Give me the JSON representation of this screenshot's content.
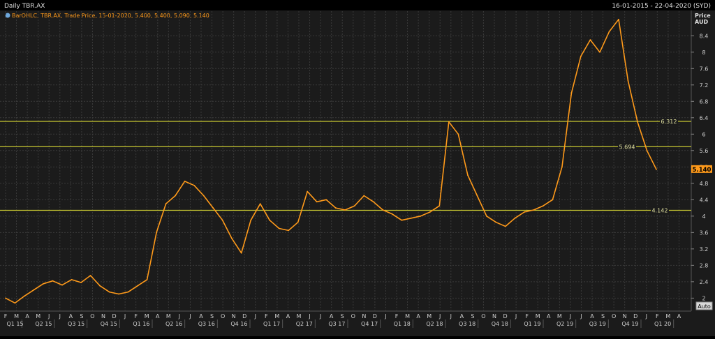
{
  "header": {
    "title": "Daily TBR.AX",
    "date_range": "16-01-2015 - 22-04-2020 (SYD)"
  },
  "legend": {
    "text": "BarOHLC, TBR.AX, Trade Price, 15-01-2020, 5.400, 5.400, 5.090, 5.140"
  },
  "axis": {
    "price_label": "Price",
    "unit_label": "AUD",
    "last_price": "5.140",
    "auto_label": "Auto"
  },
  "colors": {
    "background": "#1b1b1b",
    "grid": "#3a3a3a",
    "series": "#ff9a1a",
    "hline": "#c8c832",
    "title_bar": "#000000",
    "axis_text": "#cfcfcf",
    "last_price_bg": "#ff9a1a"
  },
  "chart_data": {
    "type": "line",
    "title": "Daily TBR.AX",
    "ylabel": "Price AUD",
    "ylim": [
      1.7,
      9.0
    ],
    "yticks": [
      "2",
      "2.4",
      "2.8",
      "3.2",
      "3.6",
      "4",
      "4.4",
      "4.8",
      "5.2",
      "5.6",
      "6",
      "6.4",
      "6.8",
      "7.2",
      "7.6",
      "8",
      "8.4"
    ],
    "months": [
      "F",
      "M",
      "A",
      "M",
      "J",
      "J",
      "A",
      "S",
      "O",
      "N",
      "D",
      "J",
      "F",
      "M",
      "A",
      "M",
      "J",
      "J",
      "A",
      "S",
      "O",
      "N",
      "D",
      "J",
      "F",
      "M",
      "A",
      "M",
      "J",
      "J",
      "A",
      "S",
      "O",
      "N",
      "D",
      "J",
      "F",
      "M",
      "A",
      "M",
      "J",
      "J",
      "A",
      "S",
      "O",
      "N",
      "D",
      "J",
      "F",
      "M",
      "A",
      "M",
      "J",
      "J",
      "A",
      "S",
      "O",
      "N",
      "D",
      "J",
      "F",
      "M",
      "A"
    ],
    "quarters": [
      "Q1 15",
      "Q2 15",
      "Q3 15",
      "Q4 15",
      "Q1 16",
      "Q2 16",
      "Q3 16",
      "Q4 16",
      "Q1 17",
      "Q2 17",
      "Q3 17",
      "Q4 17",
      "Q1 18",
      "Q2 18",
      "Q3 18",
      "Q4 18",
      "Q1 19",
      "Q2 19",
      "Q3 19",
      "Q4 19",
      "Q1 20"
    ],
    "horizontal_lines": [
      {
        "value": 6.312,
        "label": "6.312"
      },
      {
        "value": 5.694,
        "label": "5.694"
      },
      {
        "value": 4.142,
        "label": "4.142"
      }
    ],
    "series": [
      {
        "values": [
          {
            "x": 0,
            "y": 2.0
          },
          {
            "x": 1,
            "y": 1.88
          },
          {
            "x": 2,
            "y": 2.05
          },
          {
            "x": 3,
            "y": 2.2
          },
          {
            "x": 4,
            "y": 2.35
          },
          {
            "x": 5,
            "y": 2.42
          },
          {
            "x": 6,
            "y": 2.32
          },
          {
            "x": 7,
            "y": 2.45
          },
          {
            "x": 8,
            "y": 2.38
          },
          {
            "x": 9,
            "y": 2.55
          },
          {
            "x": 10,
            "y": 2.3
          },
          {
            "x": 11,
            "y": 2.15
          },
          {
            "x": 12,
            "y": 2.1
          },
          {
            "x": 13,
            "y": 2.15
          },
          {
            "x": 14,
            "y": 2.3
          },
          {
            "x": 15,
            "y": 2.45
          },
          {
            "x": 16,
            "y": 3.6
          },
          {
            "x": 17,
            "y": 4.3
          },
          {
            "x": 18,
            "y": 4.5
          },
          {
            "x": 19,
            "y": 4.85
          },
          {
            "x": 20,
            "y": 4.75
          },
          {
            "x": 21,
            "y": 4.5
          },
          {
            "x": 22,
            "y": 4.2
          },
          {
            "x": 23,
            "y": 3.9
          },
          {
            "x": 24,
            "y": 3.45
          },
          {
            "x": 25,
            "y": 3.1
          },
          {
            "x": 26,
            "y": 3.9
          },
          {
            "x": 27,
            "y": 4.3
          },
          {
            "x": 28,
            "y": 3.9
          },
          {
            "x": 29,
            "y": 3.7
          },
          {
            "x": 30,
            "y": 3.65
          },
          {
            "x": 31,
            "y": 3.85
          },
          {
            "x": 32,
            "y": 4.6
          },
          {
            "x": 33,
            "y": 4.35
          },
          {
            "x": 34,
            "y": 4.4
          },
          {
            "x": 35,
            "y": 4.2
          },
          {
            "x": 36,
            "y": 4.15
          },
          {
            "x": 37,
            "y": 4.25
          },
          {
            "x": 38,
            "y": 4.5
          },
          {
            "x": 39,
            "y": 4.35
          },
          {
            "x": 40,
            "y": 4.15
          },
          {
            "x": 41,
            "y": 4.05
          },
          {
            "x": 42,
            "y": 3.9
          },
          {
            "x": 43,
            "y": 3.95
          },
          {
            "x": 44,
            "y": 4.0
          },
          {
            "x": 45,
            "y": 4.1
          },
          {
            "x": 46,
            "y": 4.25
          },
          {
            "x": 47,
            "y": 6.3
          },
          {
            "x": 48,
            "y": 6.0
          },
          {
            "x": 49,
            "y": 5.0
          },
          {
            "x": 50,
            "y": 4.5
          },
          {
            "x": 51,
            "y": 4.0
          },
          {
            "x": 52,
            "y": 3.85
          },
          {
            "x": 53,
            "y": 3.75
          },
          {
            "x": 54,
            "y": 3.95
          },
          {
            "x": 55,
            "y": 4.1
          },
          {
            "x": 56,
            "y": 4.15
          },
          {
            "x": 57,
            "y": 4.25
          },
          {
            "x": 58,
            "y": 4.4
          },
          {
            "x": 59,
            "y": 5.2
          },
          {
            "x": 60,
            "y": 7.0
          },
          {
            "x": 61,
            "y": 7.9
          },
          {
            "x": 62,
            "y": 8.3
          },
          {
            "x": 63,
            "y": 8.0
          },
          {
            "x": 64,
            "y": 8.5
          },
          {
            "x": 65,
            "y": 8.8
          },
          {
            "x": 66,
            "y": 7.3
          },
          {
            "x": 67,
            "y": 6.3
          },
          {
            "x": 68,
            "y": 5.6
          },
          {
            "x": 69,
            "y": 5.14
          }
        ]
      }
    ]
  }
}
